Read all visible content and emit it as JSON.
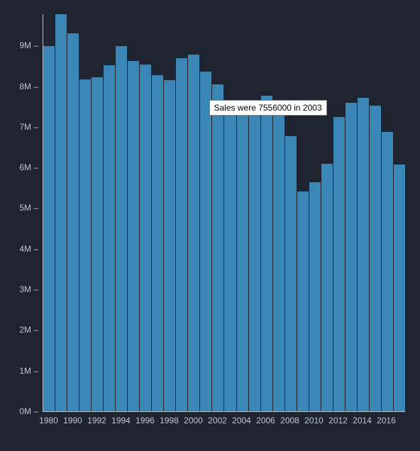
{
  "chart_data": {
    "type": "bar",
    "categories": [
      1980,
      1989,
      1990,
      1991,
      1992,
      1993,
      1994,
      1995,
      1996,
      1997,
      1998,
      1999,
      2000,
      2001,
      2002,
      2003,
      2004,
      2005,
      2006,
      2007,
      2008,
      2009,
      2010,
      2011,
      2012,
      2013,
      2014,
      2015,
      2016,
      2017
    ],
    "values": [
      8979000,
      9772000,
      9301000,
      8175000,
      8213000,
      8518000,
      8991000,
      8620000,
      8527000,
      8272000,
      8142000,
      8698000,
      8778000,
      8352000,
      8042000,
      7556000,
      7483000,
      7660000,
      7762000,
      7562000,
      6769000,
      5402000,
      5636000,
      6089000,
      7243000,
      7586000,
      7708000,
      7517000,
      6873000,
      6081000
    ],
    "ylabel": "",
    "xlabel": "",
    "ylim": [
      0,
      9772000
    ],
    "y_ticks": [
      {
        "v": 0,
        "label": "0M"
      },
      {
        "v": 1000000,
        "label": "1M"
      },
      {
        "v": 2000000,
        "label": "2M"
      },
      {
        "v": 3000000,
        "label": "3M"
      },
      {
        "v": 4000000,
        "label": "4M"
      },
      {
        "v": 5000000,
        "label": "5M"
      },
      {
        "v": 6000000,
        "label": "6M"
      },
      {
        "v": 7000000,
        "label": "7M"
      },
      {
        "v": 8000000,
        "label": "8M"
      },
      {
        "v": 9000000,
        "label": "9M"
      }
    ],
    "x_tick_labels": [
      1980,
      1990,
      1992,
      1994,
      1996,
      1998,
      2000,
      2002,
      2004,
      2006,
      2008,
      2010,
      2012,
      2014,
      2016
    ]
  },
  "tooltip": {
    "text": "Sales were 7556000 in 2003",
    "year": 2003
  }
}
